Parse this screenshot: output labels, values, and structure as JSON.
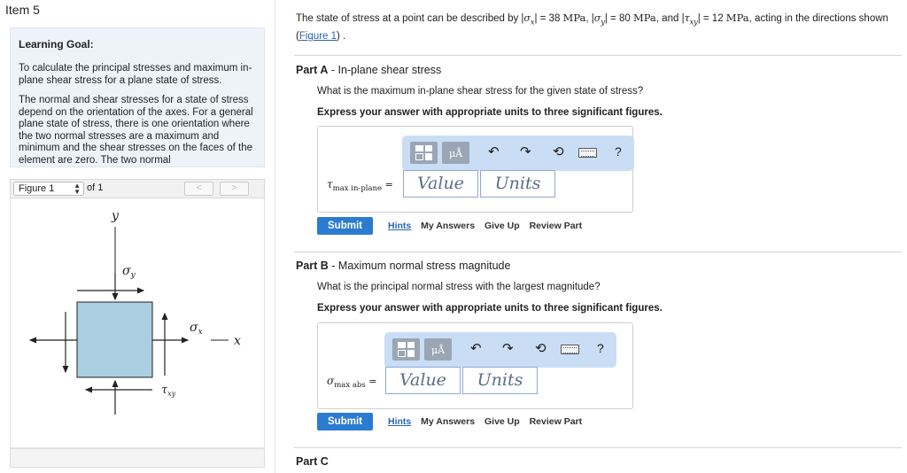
{
  "item_title": "Item 5",
  "learning_goal": {
    "title": "Learning Goal:",
    "paragraphs": [
      "To calculate the principal stresses and maximum in-plane shear stress for a plane state of stress.",
      "The normal and shear stresses for a state of stress depend on the orientation of the axes. For a general plane state of stress, there is one orientation where the two normal stresses are a maximum and minimum and the shear stresses on the faces of the element are zero. The two normal"
    ]
  },
  "figure_nav": {
    "selected": "Figure 1",
    "of_label": "of 1",
    "prev": "<",
    "next": ">"
  },
  "figure": {
    "y_label": "y",
    "x_label": "x",
    "sigma_y": "σ",
    "sigma_y_sub": "y",
    "sigma_x": "σ",
    "sigma_x_sub": "x",
    "tau": "τ",
    "tau_sub": "xy",
    "element_color": "#a9cfe0"
  },
  "intro": {
    "prefix": "The state of stress at a point can be described by ",
    "sx_sym": "σ",
    "sx_sub": "x",
    "sx_val": " = 38 ",
    "sx_unit": "MPa",
    "sep1": ", ",
    "sy_sym": "σ",
    "sy_sub": "y",
    "sy_val": " = 80 ",
    "sy_unit": "MPa",
    "sep2": ", and ",
    "txy_sym": "τ",
    "txy_sub": "xy",
    "txy_val": " = 12 ",
    "txy_unit": "MPa",
    "suffix": ", acting in the directions shown (",
    "figure_link": "Figure 1",
    "end": ") ."
  },
  "parts": [
    {
      "label": "Part A",
      "title": " - In-plane shear stress",
      "question": "What is the maximum in-plane shear stress for the given state of stress?",
      "instruction": "Express your answer with appropriate units to three significant figures.",
      "var_symbol": "τ",
      "var_sub": "max in-plane",
      "equals": "=",
      "value_placeholder": "Value",
      "units_placeholder": "Units",
      "submit": "Submit",
      "links": [
        "Hints",
        "My Answers",
        "Give Up",
        "Review Part"
      ]
    },
    {
      "label": "Part B",
      "title": " - Maximum normal stress magnitude",
      "question": "What is the principal normal stress with the largest magnitude?",
      "instruction": "Express your answer with appropriate units to three significant figures.",
      "var_symbol": "σ",
      "var_sub": "max abs",
      "equals": "=",
      "value_placeholder": "Value",
      "units_placeholder": "Units",
      "submit": "Submit",
      "links": [
        "Hints",
        "My Answers",
        "Give Up",
        "Review Part"
      ]
    },
    {
      "label": "Part C",
      "title": ""
    }
  ],
  "toolbar": {
    "units_button": "μÅ",
    "undo": "↶",
    "redo": "↷",
    "reset": "⟲",
    "help": "?"
  },
  "colors": {
    "accent": "#2b7bd0",
    "link": "#2a64b4",
    "toolbar_bg": "#c9ddf5",
    "goal_bg": "#eef3fa"
  }
}
